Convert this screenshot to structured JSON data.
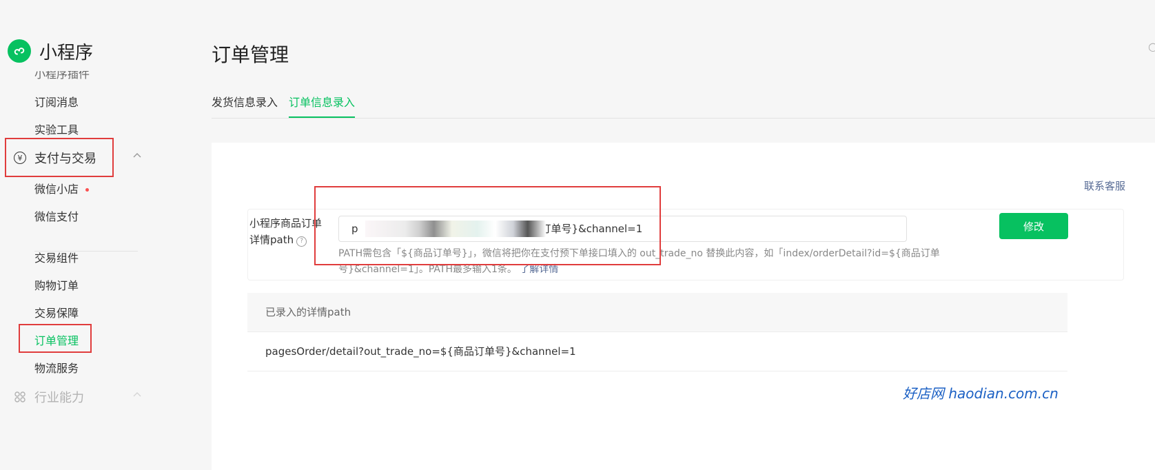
{
  "brand": {
    "title": "小程序"
  },
  "sidebar": {
    "cut_item": "小程序插件",
    "items_top": [
      {
        "label": "订阅消息"
      },
      {
        "label": "实验工具"
      }
    ],
    "group_payment": {
      "icon": "¥",
      "label": "支付与交易"
    },
    "payment_items": [
      {
        "label": "微信小店"
      },
      {
        "label": "微信支付"
      }
    ],
    "trade_items": [
      {
        "label": "交易组件"
      },
      {
        "label": "购物订单"
      },
      {
        "label": "交易保障"
      },
      {
        "label": "订单管理"
      },
      {
        "label": "物流服务"
      }
    ],
    "group_industry": {
      "label": "行业能力"
    }
  },
  "page": {
    "title": "订单管理"
  },
  "tabs": [
    {
      "label": "发货信息录入",
      "active": false
    },
    {
      "label": "订单信息录入",
      "active": true
    }
  ],
  "panel": {
    "contact_link": "联系客服",
    "form": {
      "label": "小程序商品订单详情path",
      "value_prefix": "p",
      "value_suffix": "订单号}&channel=1",
      "hint": "PATH需包含「${商品订单号}」，微信将把你在支付预下单接口填入的 out_trade_no 替换此内容，如「index/orderDetail?id=${商品订单号}&channel=1」。PATH最多输入1条。",
      "hint_link": "了解详情",
      "save_button": "修改"
    },
    "table": {
      "header": "已录入的详情path",
      "rows": [
        "pagesOrder/detail?out_trade_no=${商品订单号}&channel=1"
      ]
    }
  },
  "watermark": "好店网 haodian.com.cn",
  "colors": {
    "accent": "#07c160",
    "highlight_box": "#e03c3c",
    "link": "#576b95"
  }
}
